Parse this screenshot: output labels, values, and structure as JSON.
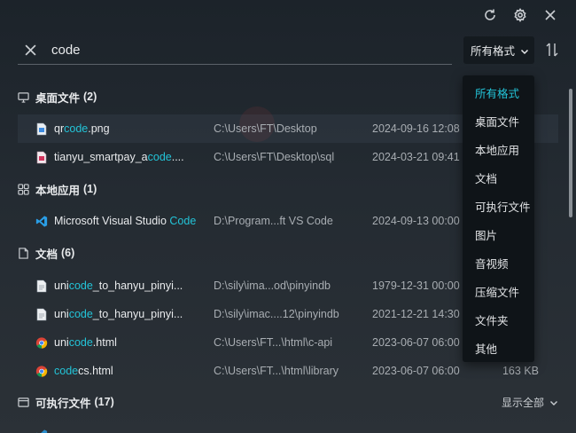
{
  "window_controls": {
    "refresh": "refresh-icon",
    "settings": "gear-icon",
    "close": "close-icon"
  },
  "search": {
    "value": "code",
    "placeholder": ""
  },
  "format_select": {
    "label": "所有格式"
  },
  "sections": [
    {
      "title": "桌面文件",
      "count": "(2)",
      "toggle": "",
      "items": [
        {
          "pre": "qr",
          "hl": "code",
          "post": ".png",
          "path": "C:\\Users\\FT\\Desktop",
          "date": "2024-09-16 12:08",
          "size": ""
        },
        {
          "pre": "tianyu_smartpay_a",
          "hl": "code",
          "post": "....",
          "path": "C:\\Users\\FT\\Desktop\\sql",
          "date": "2024-03-21 09:41",
          "size": ""
        }
      ]
    },
    {
      "title": "本地应用",
      "count": "(1)",
      "toggle": "",
      "items": [
        {
          "pre": "Microsoft Visual Studio ",
          "hl": "Code",
          "post": "",
          "path": "D:\\Program...ft VS Code",
          "date": "2024-09-13 00:00",
          "size": ""
        }
      ]
    },
    {
      "title": "文档",
      "count": "(6)",
      "toggle": "",
      "items": [
        {
          "pre": "uni",
          "hl": "code",
          "post": "_to_hanyu_pinyi...",
          "path": "D:\\sily\\ima...od\\pinyindb",
          "date": "1979-12-31 00:00",
          "size": ""
        },
        {
          "pre": "uni",
          "hl": "code",
          "post": "_to_hanyu_pinyi...",
          "path": "D:\\sily\\imac....12\\pinyindb",
          "date": "2021-12-21 14:30",
          "size": ""
        },
        {
          "pre": "uni",
          "hl": "code",
          "post": ".html",
          "path": "C:\\Users\\FT...\\html\\c-api",
          "date": "2023-06-07 06:00",
          "size": ""
        },
        {
          "pre": "",
          "hl": "code",
          "post": "cs.html",
          "path": "C:\\Users\\FT...\\html\\library",
          "date": "2023-06-07 06:00",
          "size": "163 KB"
        }
      ]
    },
    {
      "title": "可执行文件",
      "count": "(17)",
      "toggle": "显示全部",
      "items": []
    }
  ],
  "dropdown": {
    "options": [
      "所有格式",
      "桌面文件",
      "本地应用",
      "文档",
      "可执行文件",
      "图片",
      "音视频",
      "压缩文件",
      "文件夹",
      "其他"
    ],
    "selected_index": 0
  },
  "colors": {
    "accent": "#23c4d8",
    "background": "#1f262d",
    "dropdown_bg": "#0f1418"
  }
}
